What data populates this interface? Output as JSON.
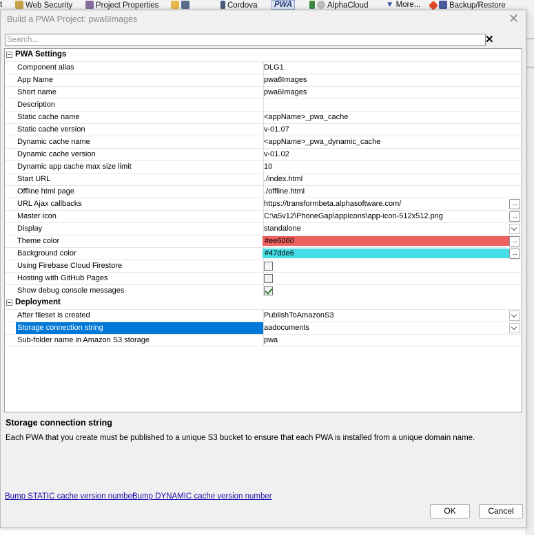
{
  "background_toolbar": {
    "items": [
      "t",
      "Web Security",
      "Project Properties",
      "Cordova",
      "PWA",
      "AlphaCloud",
      "More...",
      "Backup/Restore"
    ]
  },
  "dialog": {
    "title": "Build a PWA Project: pwa6Images",
    "close_glyph": "✕"
  },
  "search": {
    "placeholder": "Search...",
    "clear_glyph": "✕"
  },
  "grid": {
    "categories": [
      {
        "label": "PWA Settings",
        "rows": [
          {
            "label": "Component alias",
            "value": "DLG1"
          },
          {
            "label": "App Name",
            "value": "pwa6Images"
          },
          {
            "label": "Short name",
            "value": "pwa6Images"
          },
          {
            "label": "Description",
            "value": ""
          },
          {
            "label": "Static cache name",
            "value": "<appName>_pwa_cache"
          },
          {
            "label": "Static cache version",
            "value": "v-01.07"
          },
          {
            "label": "Dynamic cache name",
            "value": "<appName>_pwa_dynamic_cache"
          },
          {
            "label": "Dynamic cache version",
            "value": "v-01.02"
          },
          {
            "label": "Dynamic app cache max size limit",
            "value": "10"
          },
          {
            "label": "Start URL",
            "value": "./index.html"
          },
          {
            "label": "Offline html page",
            "value": "./offline.html"
          },
          {
            "label": "URL Ajax callbacks",
            "value": "https://transformbeta.alphasoftware.com/"
          },
          {
            "label": "Master icon",
            "value": "C:\\a5v12\\PhoneGap\\appIcons\\app-icon-512x512.png"
          },
          {
            "label": "Display",
            "value": "standalone"
          },
          {
            "label": "Theme color",
            "value": "#ee6060"
          },
          {
            "label": "Background color",
            "value": "#47dde6"
          },
          {
            "label": "Using Firebase Cloud Firestore",
            "checked": false
          },
          {
            "label": "Hosting with GitHub Pages",
            "checked": false
          },
          {
            "label": "Show debug console messages",
            "checked": true
          }
        ]
      },
      {
        "label": "Deployment",
        "rows": [
          {
            "label": "After fileset is created",
            "value": "PublishToAmazonS3"
          },
          {
            "label": "Storage connection string",
            "value": "aadocuments"
          },
          {
            "label": "Sub-folder name in Amazon S3 storage",
            "value": "pwa"
          }
        ]
      }
    ]
  },
  "colors": {
    "theme_swatch": "#ee6060",
    "background_swatch": "#47dde6",
    "selection": "#0078d7"
  },
  "help": {
    "title": "Storage connection string",
    "text": "Each PWA that you create must be published to a unique S3 bucket to ensure that each PWA is installed from a unique domain name."
  },
  "links": {
    "bump_static": "Bump STATIC cache version number",
    "bump_dynamic": "Bump DYNAMIC cache version number"
  },
  "buttons": {
    "ok": "OK",
    "cancel": "Cancel",
    "ellipsis": "...",
    "ellipsis_icon": "ellipsis-icon",
    "dropdown_icon": "chevron-down-icon"
  }
}
